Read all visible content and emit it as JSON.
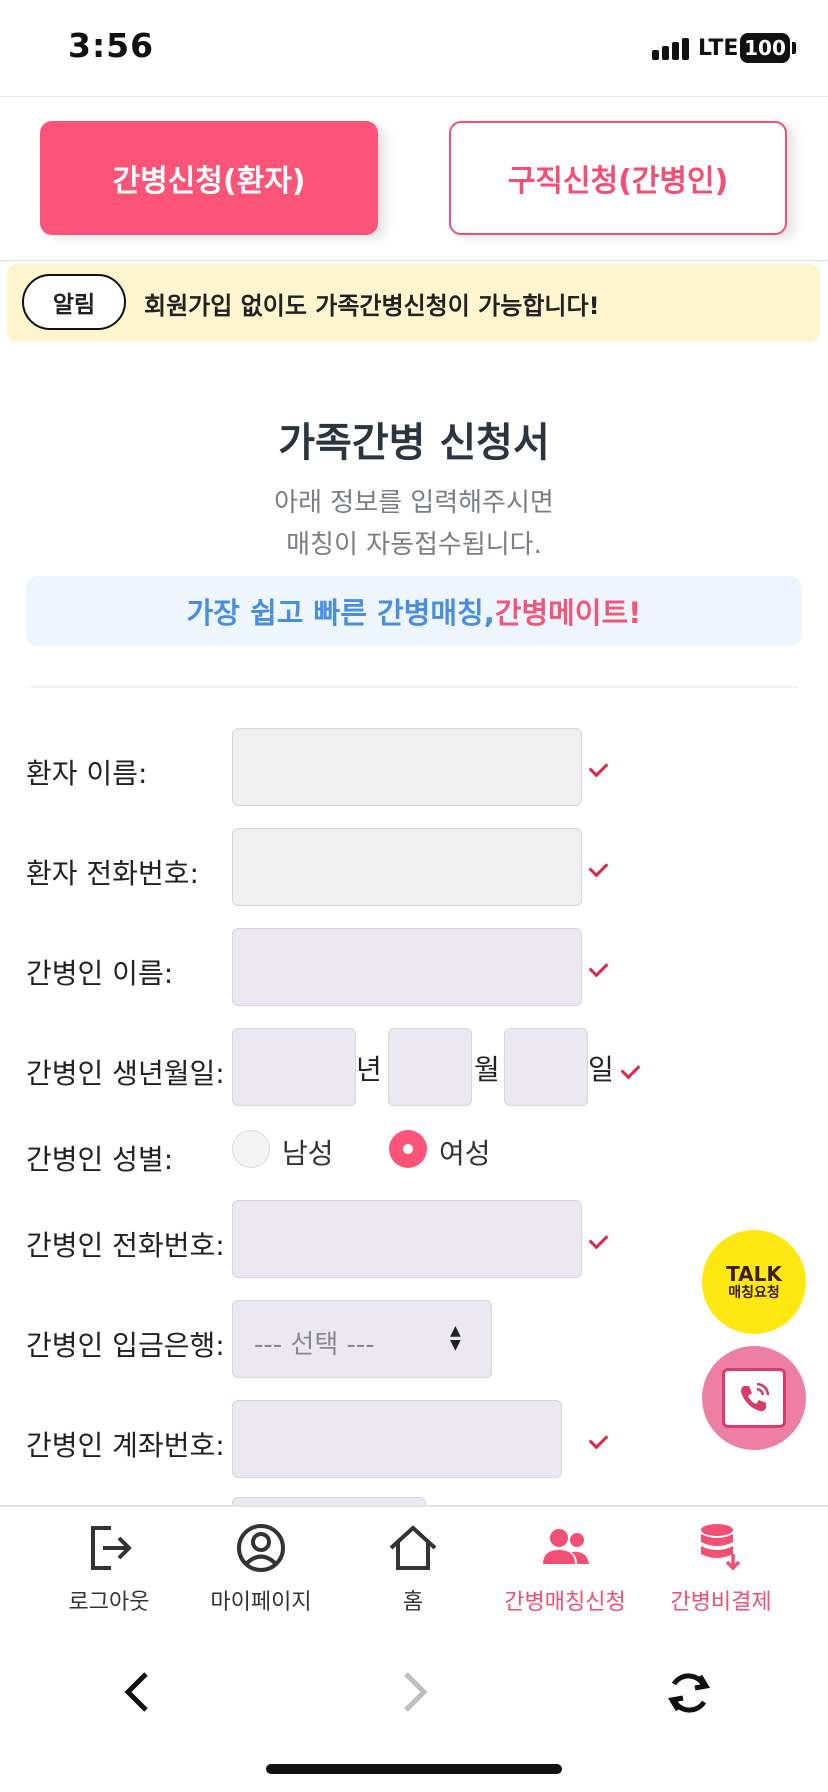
{
  "status_bar": {
    "time": "3:56",
    "network": "LTE",
    "battery": "100"
  },
  "top_tabs": {
    "patient": "간병신청(환자)",
    "caregiver": "구직신청(간병인)"
  },
  "notice": {
    "badge": "알림",
    "text": "회원가입 없이도 가족간병신청이 가능합니다!"
  },
  "form": {
    "title": "가족간병 신청서",
    "subtitle_line1": "아래 정보를 입력해주시면",
    "subtitle_line2": "매칭이 자동접수됩니다.",
    "slogan_main": "가장 쉽고 빠른 간병매칭, ",
    "slogan_brand": "간병메이트!",
    "labels": {
      "patient_name": "환자 이름:",
      "patient_phone": "환자 전화번호:",
      "caregiver_name": "간병인 이름:",
      "caregiver_birth": "간병인 생년월일:",
      "caregiver_gender": "간병인 성별:",
      "caregiver_phone": "간병인 전화번호:",
      "caregiver_bank": "간병인 입금은행:",
      "caregiver_account": "간병인 계좌번호:"
    },
    "birth_units": {
      "year": "년",
      "month": "월",
      "day": "일"
    },
    "gender_options": {
      "male": "남성",
      "female": "여성",
      "selected": "female"
    },
    "bank_placeholder": "--- 선택 ---"
  },
  "floating": {
    "talk_line1": "TALK",
    "talk_line2": "매칭요청"
  },
  "bottom_nav": {
    "logout": "로그아웃",
    "mypage": "마이페이지",
    "home": "홈",
    "matching": "간병매칭신청",
    "payment": "간병비결제"
  },
  "colors": {
    "accent": "#fb5478",
    "notice_bg": "#fcf5cd",
    "slogan_blue": "#4a8ee0",
    "field_bg": "#ece8f2"
  }
}
